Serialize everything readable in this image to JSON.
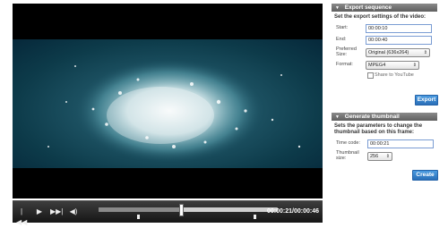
{
  "player": {
    "controls": {
      "prev_icon": "skip-back-icon",
      "play_icon": "play-icon",
      "next_icon": "skip-forward-icon",
      "volume_icon": "volume-icon"
    },
    "time_readout": "00:00:21/00:00:46",
    "progress_fraction": 0.46,
    "export_start_fraction": 0.22,
    "export_end_fraction": 0.87
  },
  "export_panel": {
    "title": "Export sequence",
    "intro": "Set the export settings of the video:",
    "start_label": "Start:",
    "start_value": "00:00:10",
    "end_label": "End:",
    "end_value": "00:00:40",
    "size_label": "Preferred Size:",
    "size_value": "Original (636x264)",
    "format_label": "Format:",
    "format_value": "MPEG4",
    "youtube_label": "Share to YouTube",
    "youtube_checked": false,
    "export_button": "Export"
  },
  "thumbnail_panel": {
    "title": "Generate thumbnail",
    "intro": "Sets the parameters to change the thumbnail based on this frame:",
    "timecode_label": "Time code:",
    "timecode_value": "00:00:21",
    "size_label": "Thumbnail size:",
    "size_value": "256",
    "create_button": "Create"
  },
  "colors": {
    "header_bg": "#6f6f6f",
    "button_blue": "#2f7cc7",
    "field_border": "#7a9cd3"
  }
}
